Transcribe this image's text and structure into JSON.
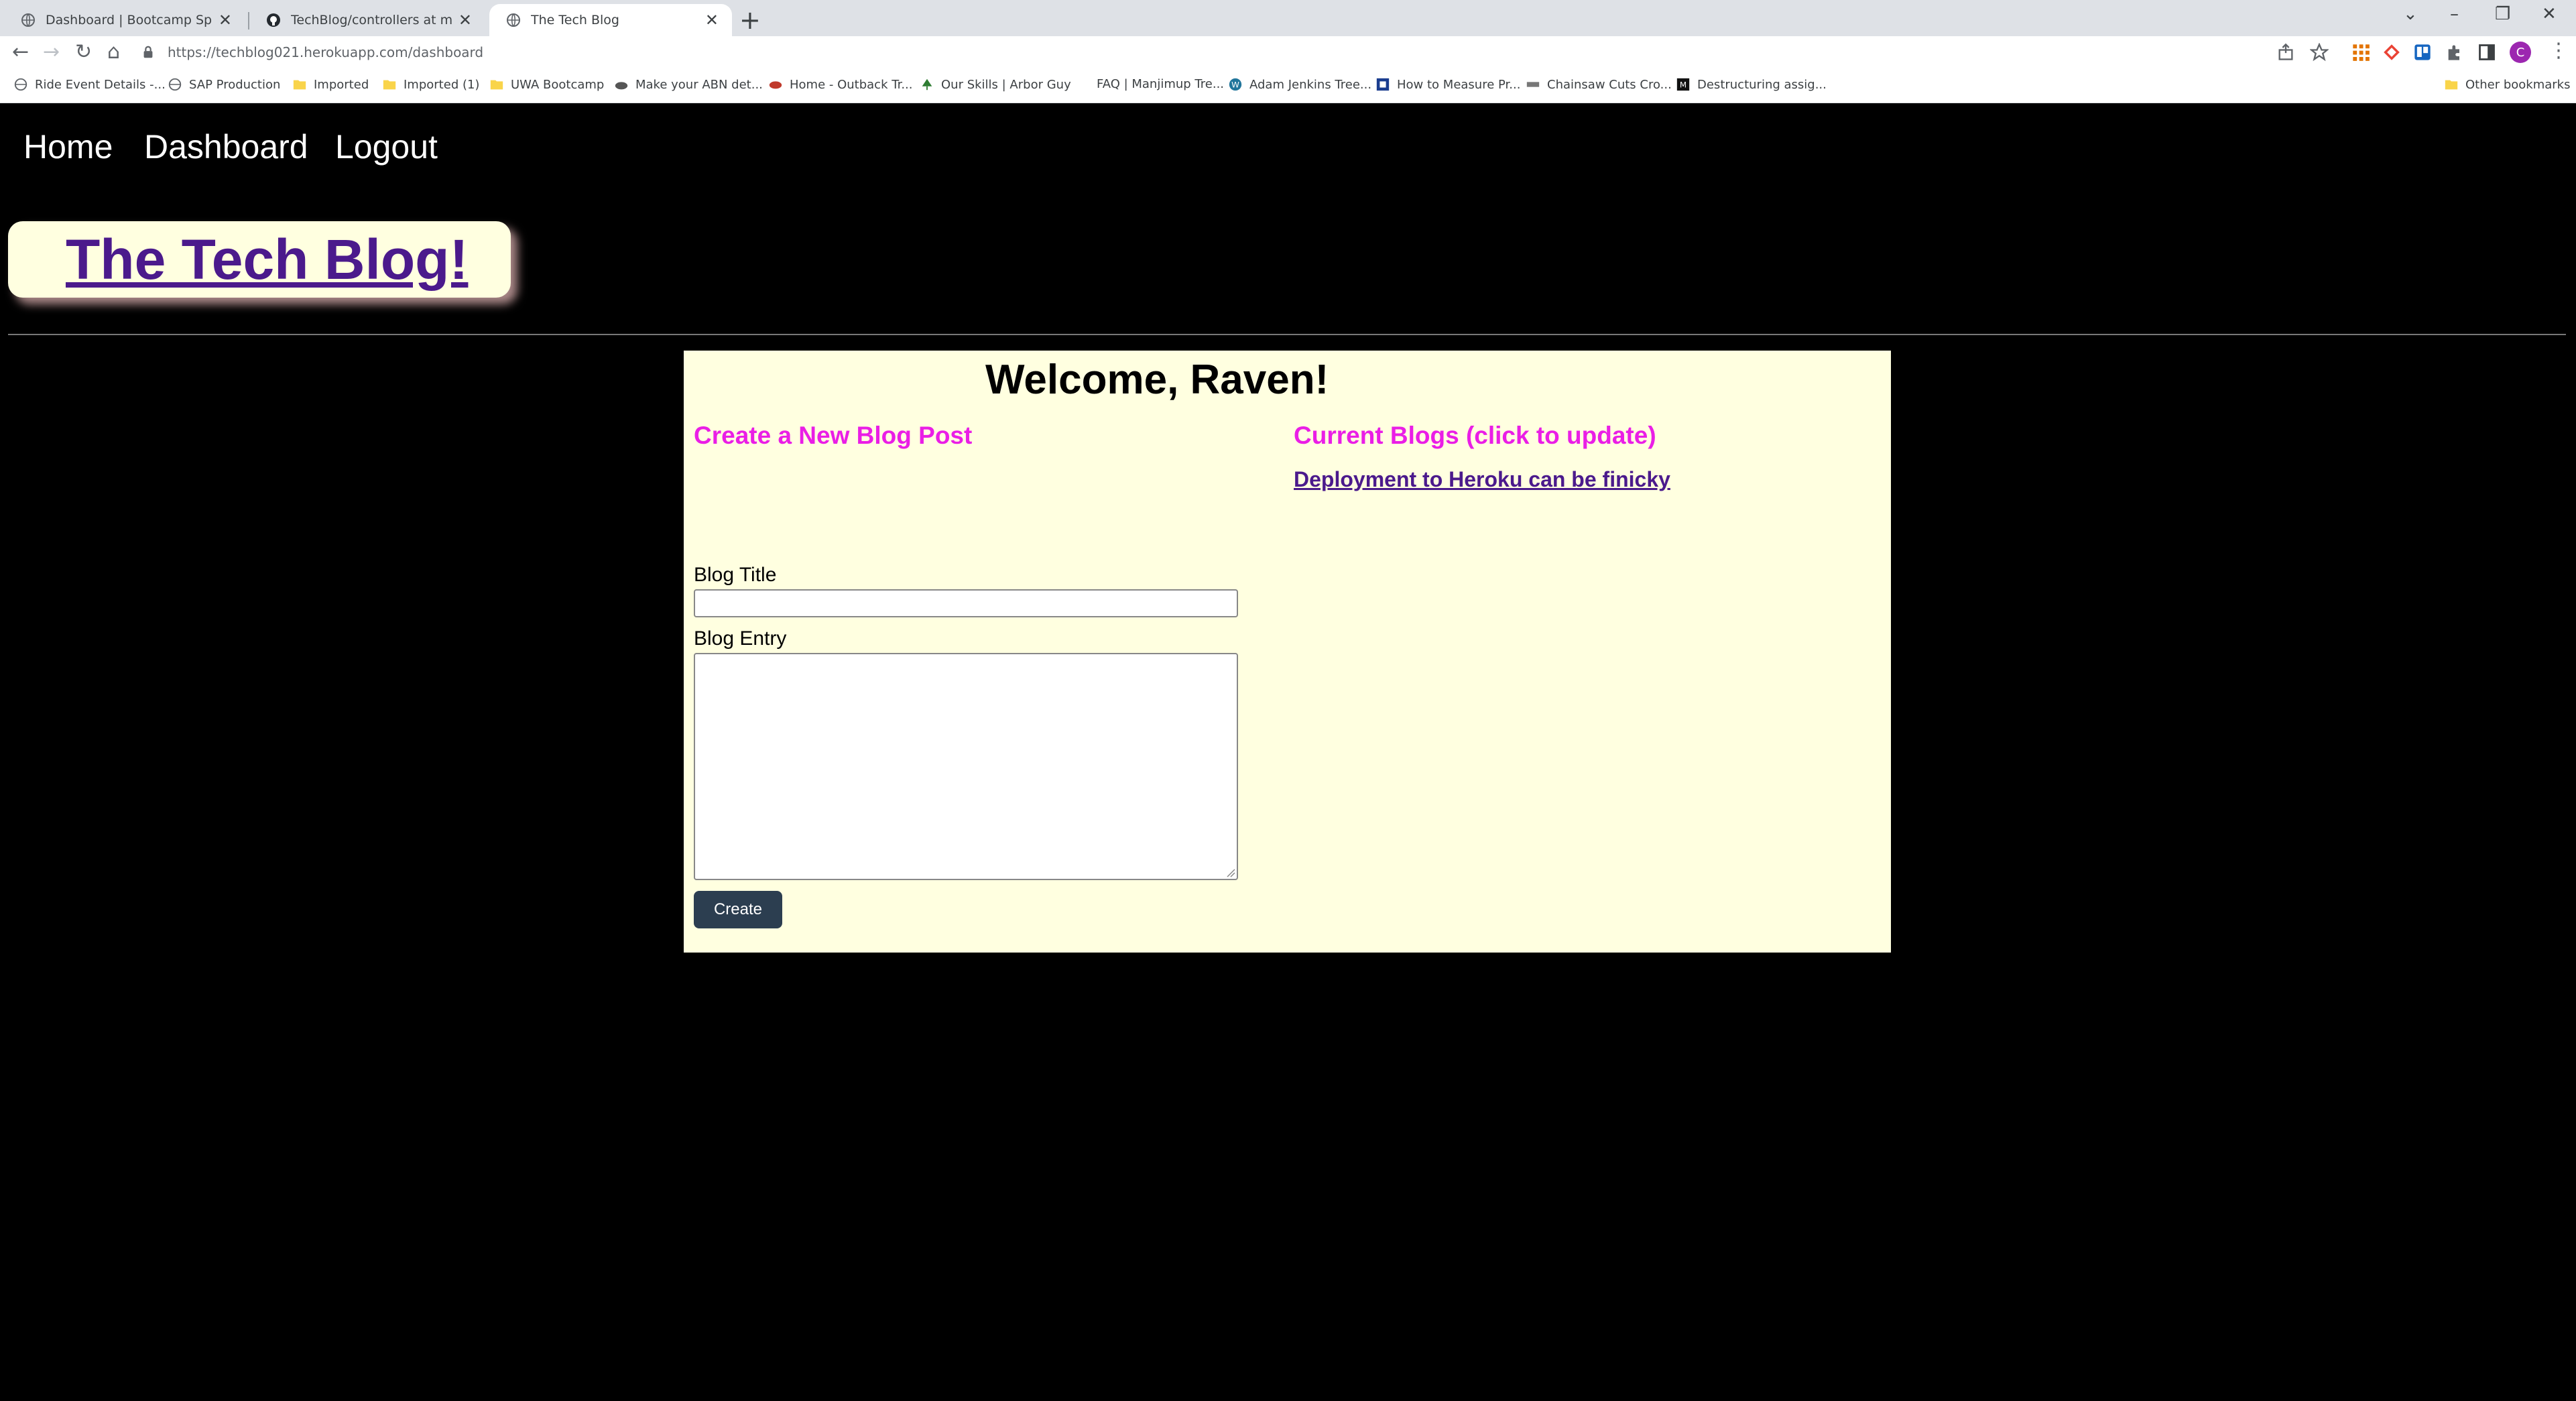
{
  "browser": {
    "tabs": [
      {
        "title": "Dashboard | Bootcamp Spot",
        "icon": "globe-icon",
        "active": false
      },
      {
        "title": "TechBlog/controllers at main · Ca",
        "icon": "github-icon",
        "active": false
      },
      {
        "title": "The Tech Blog",
        "icon": "globe-icon",
        "active": true
      }
    ],
    "url": "https://techblog021.herokuapp.com/dashboard",
    "profile_initial": "C",
    "bookmarks": [
      "Ride Event Details -...",
      "SAP Production",
      "Imported",
      "Imported (1)",
      "UWA Bootcamp",
      "Make your ABN det...",
      "Home - Outback Tr...",
      "Our Skills | Arbor Guy",
      "FAQ | Manjimup Tre...",
      "Adam Jenkins Tree...",
      "How to Measure Pr...",
      "Chainsaw Cuts Cro...",
      "Destructuring assig..."
    ],
    "other_bookmarks": "Other bookmarks"
  },
  "nav": {
    "home": "Home",
    "dashboard": "Dashboard",
    "logout": "Logout"
  },
  "site": {
    "title": "The Tech Blog!"
  },
  "dashboard": {
    "welcome": "Welcome, Raven!",
    "create_heading": "Create a New Blog Post",
    "title_label": "Blog Title",
    "title_value": "",
    "entry_label": "Blog Entry",
    "entry_value": "",
    "create_button": "Create",
    "current_heading": "Current Blogs (click to update)",
    "blogs": [
      "Deployment to Heroku can be finicky"
    ]
  },
  "colors": {
    "page_bg": "#000000",
    "card_bg": "#ffffe0",
    "heading_magenta": "#ea1ee6",
    "link_purple": "#4b1a8c",
    "button_bg": "#2c3e50"
  }
}
